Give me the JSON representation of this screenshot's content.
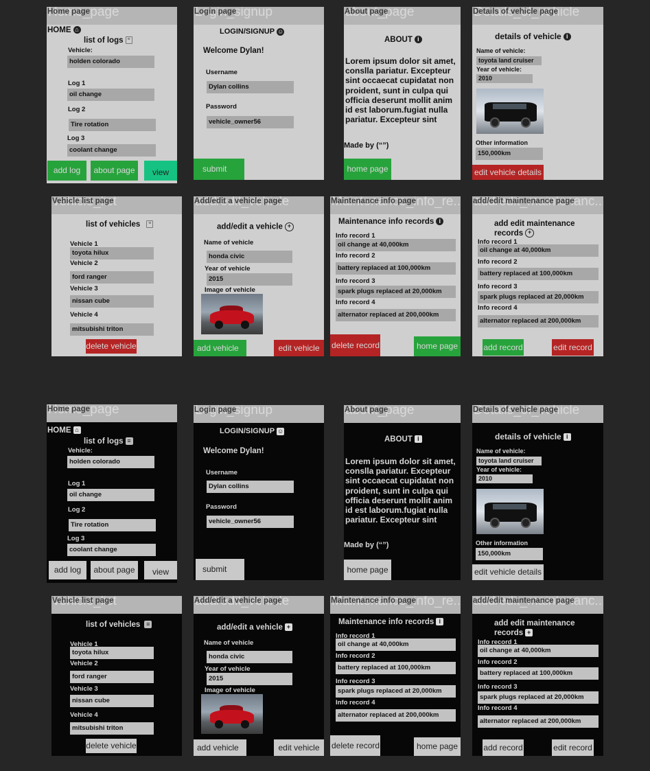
{
  "home": {
    "ghost": "Home_page",
    "title": "Home page",
    "home_label": "HOME",
    "home_icon": "home-icon",
    "list_title": "list of logs",
    "vehicle_label": "Vehicle:",
    "vehicle_value": "holden colorado",
    "log1_label": "Log 1",
    "log1_value": "oil change",
    "log2_label": "Log 2",
    "log2_value": "Tire rotation",
    "log3_label": "Log 3",
    "log3_value": "coolant change",
    "add_log": "add log",
    "about_page": "about page",
    "view": "view"
  },
  "login": {
    "ghost": "Login_signup",
    "title": "Login page",
    "heading": "LOGIN/SIGNUP",
    "welcome": "Welcome Dylan!",
    "username_label": "Username",
    "username_value": "Dylan collins",
    "password_label": "Password",
    "password_value": "vehicle_owner56",
    "submit": "submit"
  },
  "about": {
    "ghost": "about_page",
    "title": "About page",
    "heading": "ABOUT",
    "body": "Lorem ipsum dolor sit amet, conslla pariatur. Excepteur sint occaecat cupidatat non proident, sunt in culpa qui officia deserunt mollit anim id est laborum.fugiat nulla pariatur. Excepteur sint",
    "made_by": "Made by (“”)",
    "home_page": "home page"
  },
  "details": {
    "ghost": "Details_of_vehicle",
    "title": "Details of vehicle page",
    "heading": "details of vehicle",
    "name_label": "Name of vehicle:",
    "name_value": "toyota land cruiser",
    "year_label": "Year of vehicle:",
    "year_value": "2010",
    "other_label": "Other information",
    "other_value": "150,000km",
    "edit": "edit vehicle details"
  },
  "vlist": {
    "ghost": "vehicle_list",
    "title": "Vehicle list page",
    "heading": "list of vehicles",
    "v1_label": "Vehicle 1",
    "v1_value": "toyota hilux",
    "v2_label": "Vehicle 2",
    "v2_value": "ford ranger",
    "v3_label": "Vehicle 3",
    "v3_value": "nissan cube",
    "v4_label": "Vehicle 4",
    "v4_value": "mitsubishi triton",
    "delete": "delete vehicle"
  },
  "addveh": {
    "ghost": "add/edit_vehicle",
    "title": "Add/edit a vehicle page",
    "heading": "add/edit a vehicle",
    "name_label": "Name of vehicle",
    "name_value": "honda civic",
    "year_label": "Year of vehicle",
    "year_value": "2015",
    "image_label": "Image of vehicle",
    "add": "add vehicle",
    "edit": "edit vehicle"
  },
  "maint": {
    "ghost": "Maintenance_info_re...",
    "title": "Maintenance info page",
    "heading": "Maintenance info records",
    "r1_label": "Info record 1",
    "r1_value": "oil change at 40,000km",
    "r2_label": "Info record 2",
    "r2_value": "battery replaced at 100,000km",
    "r3_label": "Info record 3",
    "r3_value": "spark plugs replaced at 20,000km",
    "r4_label": "Info record 4",
    "r4_value": "alternator replaced at 200,000km",
    "delete": "delete record",
    "home_page": "home page"
  },
  "addmaint": {
    "ghost": "add/edit_maintenanc...",
    "title": "add/edit maintenance page",
    "heading": "add edit maintenance records",
    "r1_label": "Info record 1",
    "r1_value": "oil change at 40,000km",
    "r2_label": "Info record 2",
    "r2_value": "battery replaced at 100,000km",
    "r3_label": "Info record 3",
    "r3_value": "spark plugs replaced at 20,000km",
    "r4_label": "Info record 4",
    "r4_value": "alternator replaced at 200,000km",
    "add": "add record",
    "edit": "edit record"
  },
  "colors": {
    "background": "#262626",
    "light_frame": "#cfcfcf",
    "dark_frame": "#070707",
    "header": "#b5b5b5",
    "field": "#a8a8a8",
    "green": "#27a33c",
    "red": "#b52424",
    "teal": "#16c282"
  }
}
